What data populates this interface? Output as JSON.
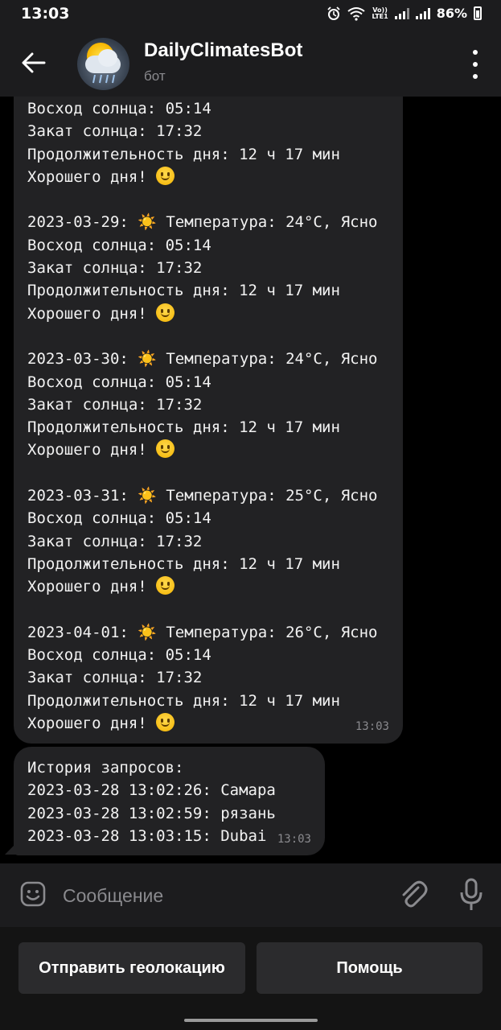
{
  "status_bar": {
    "time": "13:03",
    "lte_top": "Vo))",
    "lte_bottom": "LTE1",
    "battery": "86%",
    "icons": [
      "alarm-icon",
      "wifi-icon",
      "lte-icon",
      "signal-icon",
      "signal-icon",
      "battery-icon"
    ]
  },
  "header": {
    "title": "DailyClimatesBot",
    "subtitle": "бот",
    "back_icon": "arrow-left-icon",
    "menu_icon": "more-vertical-icon"
  },
  "messages": [
    {
      "lines": [
        "Восход солнца: 05:14",
        "Закат солнца: 17:32",
        "Продолжительность дня: 12 ч 17 мин",
        "Хорошего дня! ",
        "",
        "2023-03-29: ☀️ Температура: 24°C, Ясно",
        "Восход солнца: 05:14",
        "Закат солнца: 17:32",
        "Продолжительность дня: 12 ч 17 мин",
        "Хорошего дня! ",
        "",
        "2023-03-30: ☀️ Температура: 24°C, Ясно",
        "Восход солнца: 05:14",
        "Закат солнца: 17:32",
        "Продолжительность дня: 12 ч 17 мин",
        "Хорошего дня! ",
        "",
        "2023-03-31: ☀️ Температура: 25°C, Ясно",
        "Восход солнца: 05:14",
        "Закат солнца: 17:32",
        "Продолжительность дня: 12 ч 17 мин",
        "Хорошего дня! ",
        "",
        "2023-04-01: ☀️ Температура: 26°C, Ясно",
        "Восход солнца: 05:14",
        "Закат солнца: 17:32",
        "Продолжительность дня: 12 ч 17 мин",
        "Хорошего дня! "
      ],
      "time": "13:03"
    },
    {
      "lines": [
        "История запросов:",
        "2023-03-28 13:02:26: Самара",
        "2023-03-28 13:02:59: рязань",
        "2023-03-28 13:03:15: Dubai"
      ],
      "time": "13:03"
    }
  ],
  "composer": {
    "placeholder": "Сообщение",
    "emoji_icon": "emoji-icon",
    "attach_icon": "paperclip-icon",
    "mic_icon": "microphone-icon"
  },
  "keyboard": {
    "buttons": [
      "Отправить геолокацию",
      "Помощь"
    ]
  }
}
